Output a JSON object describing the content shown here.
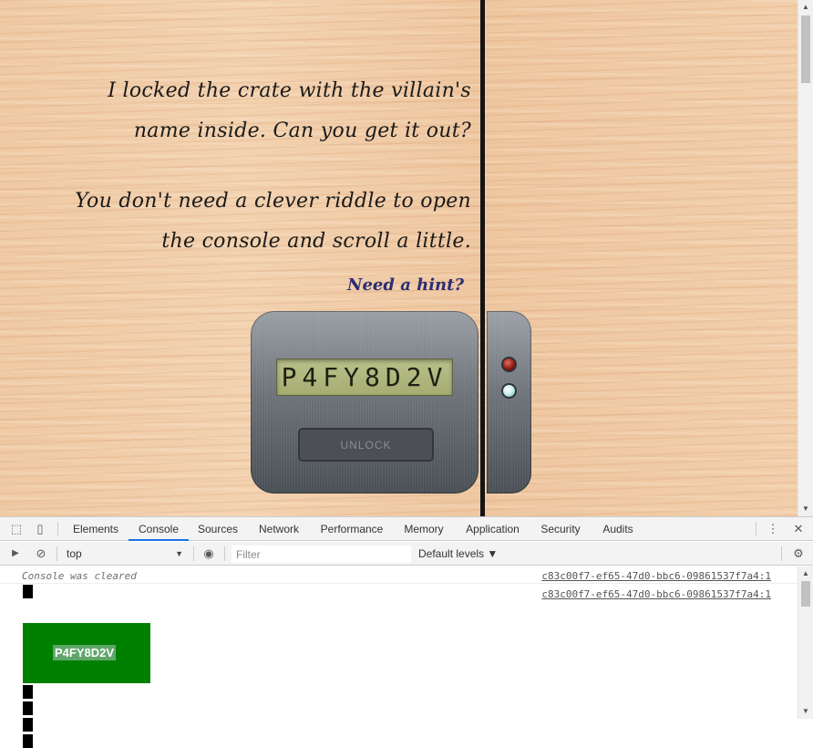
{
  "page": {
    "line1": "I locked the crate with the villain's",
    "line2": "name inside. Can you get it out?",
    "line3": "You don't need a clever riddle to open",
    "line4": "the console and scroll a little.",
    "hint_link": "Need a hint?",
    "lock": {
      "display_code": "P4FY8D2V",
      "unlock_label": "UNLOCK",
      "led_top_color": "#8b1a12",
      "led_bottom_color": "#c8f0ef"
    },
    "scroll_up_icon": "▲",
    "scroll_down_icon": "▼"
  },
  "devtools": {
    "icons": {
      "inspect": "⬚",
      "device": "▯",
      "more": "⋮",
      "close": "✕",
      "sidebar": "▶",
      "clear": "⊘",
      "eye": "◉",
      "gear": "⚙"
    },
    "tabs": [
      "Elements",
      "Console",
      "Sources",
      "Network",
      "Performance",
      "Memory",
      "Application",
      "Security",
      "Audits"
    ],
    "active_tab": "Console",
    "toolbar": {
      "context": "top",
      "context_arrow": "▼",
      "filter_placeholder": "Filter",
      "levels": "Default levels ▼"
    },
    "console": {
      "cleared_text": "Console was cleared",
      "source_link": "c83c00f7-ef65-47d0-bbc6-09861537f7a4:1",
      "secret_label": "P4FY8D2V",
      "accent_green": "#008000"
    },
    "scroll_up_icon": "▲",
    "scroll_down_icon": "▼"
  }
}
